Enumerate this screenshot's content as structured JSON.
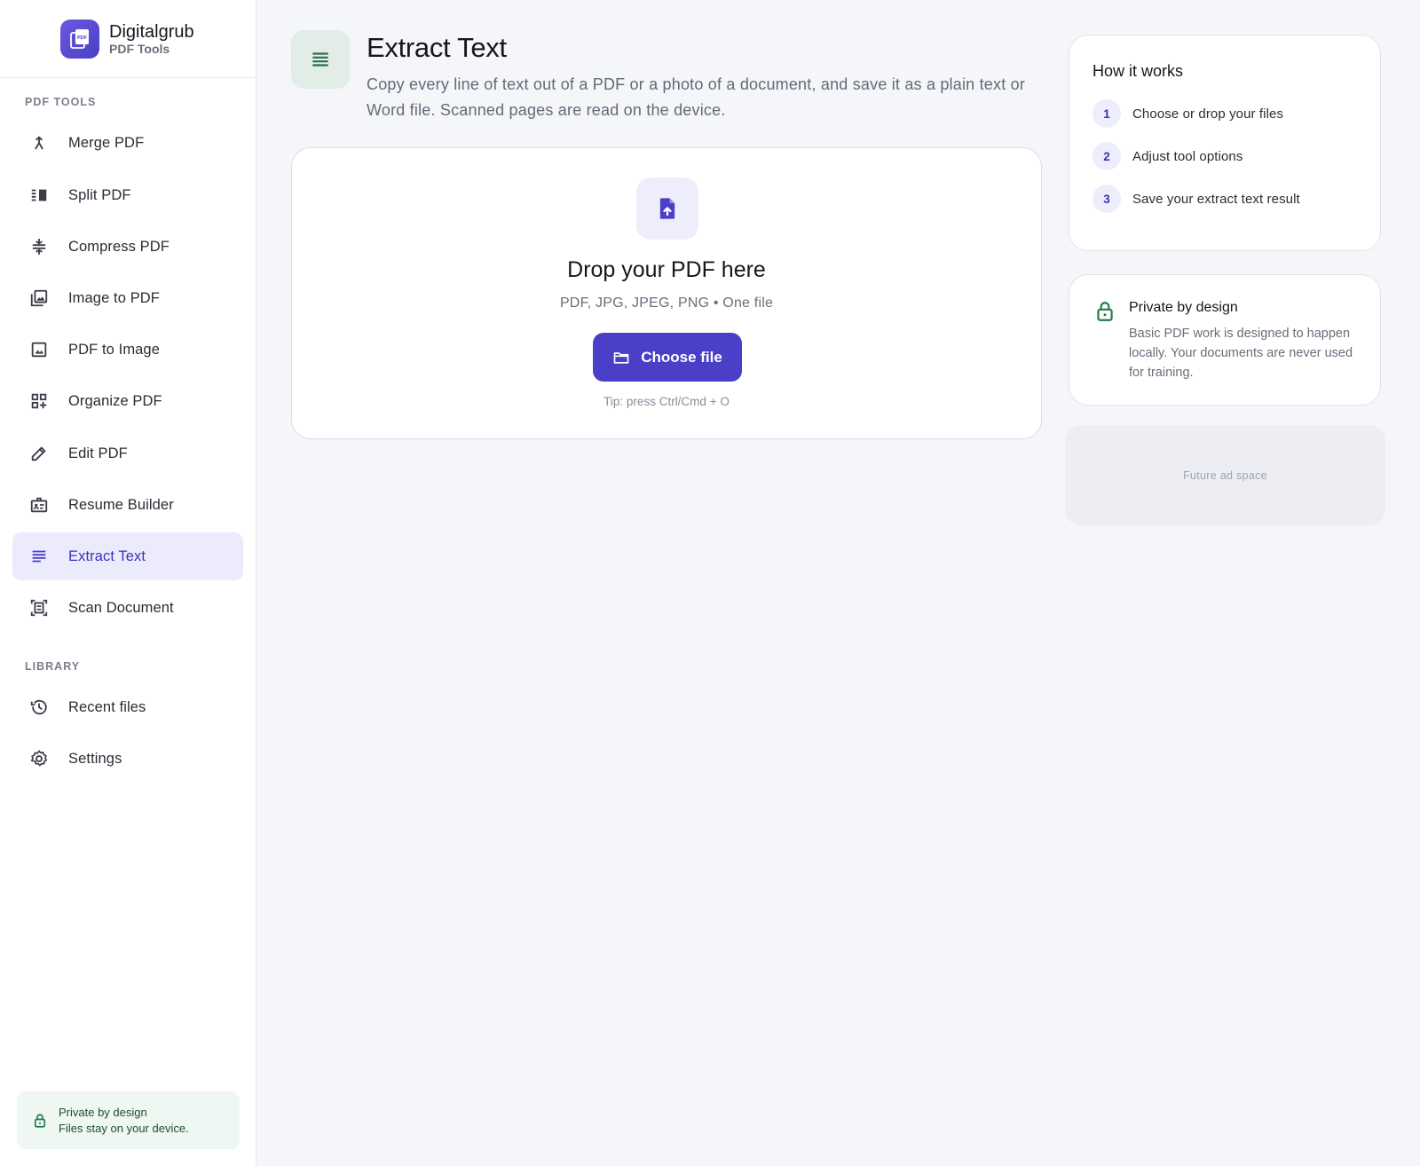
{
  "brand": {
    "name": "Digitalgrub",
    "subtitle": "PDF Tools",
    "logo_text": "PDF",
    "logo_icon": "pdf-stack-icon"
  },
  "sidebar": {
    "tools_label": "PDF TOOLS",
    "tools": [
      {
        "label": "Merge PDF",
        "icon": "merge-icon"
      },
      {
        "label": "Split PDF",
        "icon": "split-icon"
      },
      {
        "label": "Compress PDF",
        "icon": "compress-icon"
      },
      {
        "label": "Image to PDF",
        "icon": "image-stack-icon"
      },
      {
        "label": "PDF to Image",
        "icon": "image-icon"
      },
      {
        "label": "Organize PDF",
        "icon": "grid-add-icon"
      },
      {
        "label": "Edit PDF",
        "icon": "pencil-icon"
      },
      {
        "label": "Resume Builder",
        "icon": "id-card-icon"
      },
      {
        "label": "Extract Text",
        "icon": "text-lines-icon",
        "active": true
      },
      {
        "label": "Scan Document",
        "icon": "scan-icon"
      }
    ],
    "library_label": "LIBRARY",
    "library": [
      {
        "label": "Recent files",
        "icon": "history-icon"
      },
      {
        "label": "Settings",
        "icon": "gear-icon"
      }
    ],
    "privacy": {
      "title": "Private by design",
      "body": "Files stay on your device."
    }
  },
  "page": {
    "title": "Extract Text",
    "description": "Copy every line of text out of a PDF or a photo of a document, and save it as a plain text or Word file. Scanned pages are read on the device.",
    "icon": "text-lines-icon"
  },
  "dropzone": {
    "icon": "file-upload-icon",
    "title": "Drop your PDF here",
    "formats": "PDF, JPG, JPEG, PNG • One file",
    "button_label": "Choose file",
    "button_icon": "folder-icon",
    "tip": "Tip: press Ctrl/Cmd + O"
  },
  "how_it_works": {
    "title": "How it works",
    "steps": [
      {
        "num": "1",
        "label": "Choose or drop your files"
      },
      {
        "num": "2",
        "label": "Adjust tool options"
      },
      {
        "num": "3",
        "label": "Save your extract text result"
      }
    ]
  },
  "privacy_card": {
    "title": "Private by design",
    "body": "Basic PDF work is designed to happen locally. Your documents are never used for training."
  },
  "ad": {
    "label": "Future ad space"
  },
  "colors": {
    "accent": "#4a3fc7",
    "accent_soft": "#ecebfc",
    "green": "#1f7a4c",
    "green_soft": "#eef7f1",
    "background": "#f5f6fa"
  }
}
